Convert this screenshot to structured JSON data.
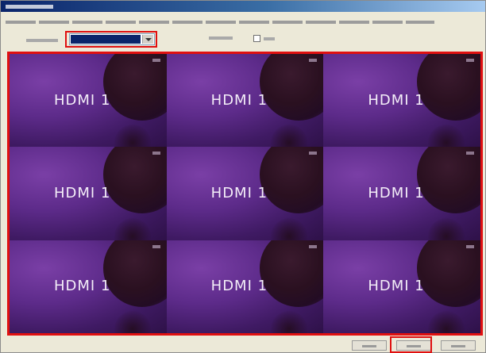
{
  "window": {
    "title": ""
  },
  "instructions": "",
  "controls": {
    "mode_label": "",
    "mode_dropdown_value": "",
    "output_label": "",
    "output_checkbox_label": ""
  },
  "preview": {
    "tiles": [
      {
        "label": "HDMI 1"
      },
      {
        "label": "HDMI 1"
      },
      {
        "label": "HDMI 1"
      },
      {
        "label": "HDMI 1"
      },
      {
        "label": "HDMI 1"
      },
      {
        "label": "HDMI 1"
      },
      {
        "label": "HDMI 1"
      },
      {
        "label": "HDMI 1"
      },
      {
        "label": "HDMI 1"
      }
    ]
  },
  "buttons": {
    "back": "",
    "next": "",
    "cancel": ""
  },
  "colors": {
    "highlight": "#e01010",
    "titlebar": "#0a246a",
    "tile_background": "#5d2b8a",
    "dialog_background": "#ece9d8"
  }
}
